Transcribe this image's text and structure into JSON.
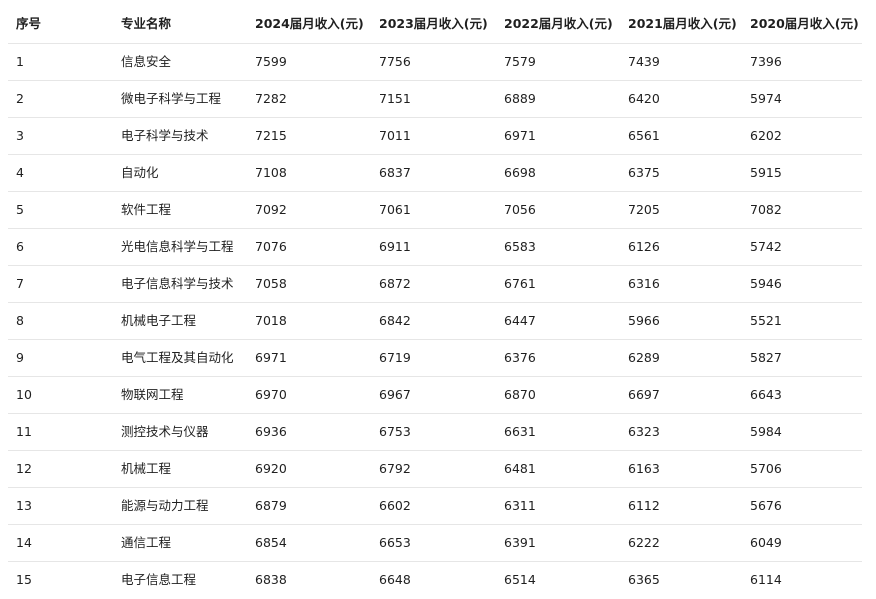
{
  "table": {
    "headers": [
      "序号",
      "专业名称",
      "2024届月收入(元)",
      "2023届月收入(元)",
      "2022届月收入(元)",
      "2021届月收入(元)",
      "2020届月收入(元)"
    ],
    "rows": [
      [
        "1",
        "信息安全",
        "7599",
        "7756",
        "7579",
        "7439",
        "7396"
      ],
      [
        "2",
        "微电子科学与工程",
        "7282",
        "7151",
        "6889",
        "6420",
        "5974"
      ],
      [
        "3",
        "电子科学与技术",
        "7215",
        "7011",
        "6971",
        "6561",
        "6202"
      ],
      [
        "4",
        "自动化",
        "7108",
        "6837",
        "6698",
        "6375",
        "5915"
      ],
      [
        "5",
        "软件工程",
        "7092",
        "7061",
        "7056",
        "7205",
        "7082"
      ],
      [
        "6",
        "光电信息科学与工程",
        "7076",
        "6911",
        "6583",
        "6126",
        "5742"
      ],
      [
        "7",
        "电子信息科学与技术",
        "7058",
        "6872",
        "6761",
        "6316",
        "5946"
      ],
      [
        "8",
        "机械电子工程",
        "7018",
        "6842",
        "6447",
        "5966",
        "5521"
      ],
      [
        "9",
        "电气工程及其自动化",
        "6971",
        "6719",
        "6376",
        "6289",
        "5827"
      ],
      [
        "10",
        "物联网工程",
        "6970",
        "6967",
        "6870",
        "6697",
        "6643"
      ],
      [
        "11",
        "测控技术与仪器",
        "6936",
        "6753",
        "6631",
        "6323",
        "5984"
      ],
      [
        "12",
        "机械工程",
        "6920",
        "6792",
        "6481",
        "6163",
        "5706"
      ],
      [
        "13",
        "能源与动力工程",
        "6879",
        "6602",
        "6311",
        "6112",
        "5676"
      ],
      [
        "14",
        "通信工程",
        "6854",
        "6653",
        "6391",
        "6222",
        "6049"
      ],
      [
        "15",
        "电子信息工程",
        "6838",
        "6648",
        "6514",
        "6365",
        "6114"
      ]
    ]
  }
}
